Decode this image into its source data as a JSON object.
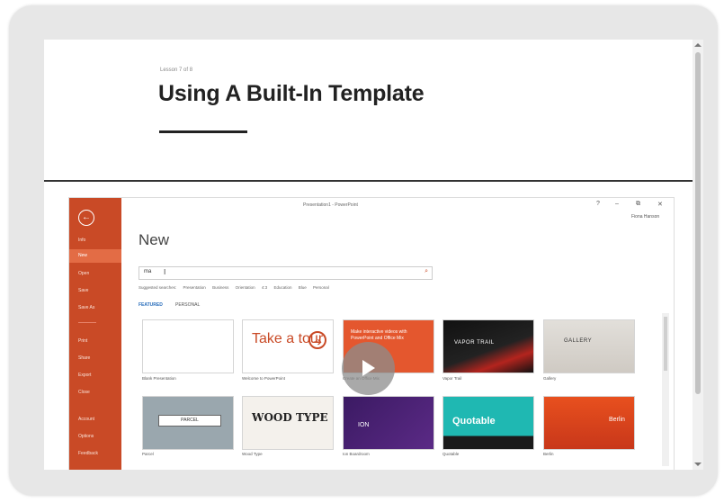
{
  "lesson": {
    "counter": "Lesson 7 of 8",
    "title": "Using A Built-In Template"
  },
  "powerpoint": {
    "window_title": "Presentation1 - PowerPoint",
    "controls": {
      "help": "?",
      "minimize": "–",
      "restore": "⧉",
      "close": "✕"
    },
    "user": "Fiona Hanson",
    "heading": "New",
    "back_icon": "←",
    "sidebar": {
      "items": [
        {
          "label": "Info"
        },
        {
          "label": "New"
        },
        {
          "label": "Open"
        },
        {
          "label": "Save"
        },
        {
          "label": "Save As"
        },
        {
          "label": "Print"
        },
        {
          "label": "Share"
        },
        {
          "label": "Export"
        },
        {
          "label": "Close"
        },
        {
          "label": "Account"
        },
        {
          "label": "Options"
        },
        {
          "label": "Feedback"
        }
      ]
    },
    "search": {
      "value": "ma",
      "icon": "⌕"
    },
    "suggested": {
      "label": "Suggested searches:",
      "items": [
        "Presentation",
        "Business",
        "Orientation",
        "4:3",
        "Education",
        "Blue",
        "Personal"
      ]
    },
    "tabs": {
      "featured": "FEATURED",
      "personal": "PERSONAL"
    },
    "templates": {
      "blank": "Blank Presentation",
      "tour": "Welcome to PowerPoint",
      "tour_text": "Take a tour",
      "tour_arrow": "➔",
      "video": "Create an Office Mix",
      "video_text": "Make interactive videos with PowerPoint and Office Mix",
      "vapor": "Vapor Trail",
      "vapor_text": "VAPOR TRAIL",
      "gallery": "Gallery",
      "gallery_text": "GALLERY",
      "parcel": "Parcel",
      "parcel_text": "PARCEL",
      "woodtype": "Wood Type",
      "woodtype_text": "WOOD TYPE",
      "ion": "Ion Boardroom",
      "ion_text": "ION",
      "quotable": "Quotable",
      "quotable_text": "Quotable",
      "berlin": "Berlin",
      "berlin_text": "Berlin"
    }
  },
  "colors": {
    "accent": "#c94a26",
    "sidebar_active": "#e36c45",
    "link": "#2a6ebb"
  }
}
